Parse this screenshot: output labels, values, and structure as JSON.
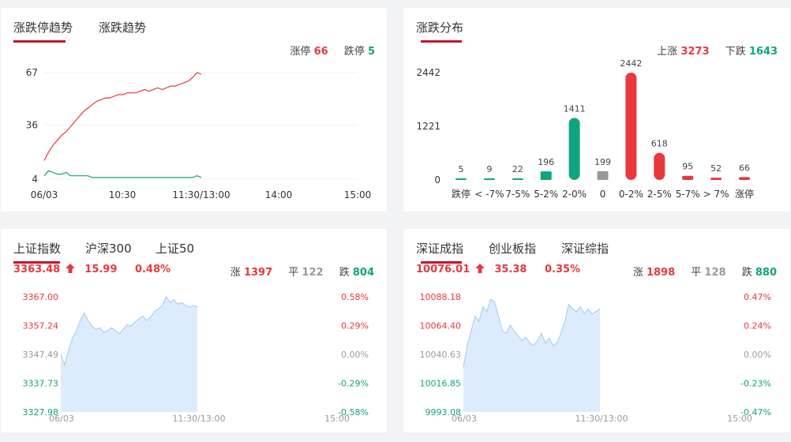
{
  "panel_limit": {
    "tabs": [
      "涨跌停趋势",
      "涨跌趋势"
    ],
    "limit_up_label": "涨停",
    "limit_up_value": "66",
    "limit_down_label": "跌停",
    "limit_down_value": "5"
  },
  "panel_dist": {
    "tabs": [
      "涨跌分布"
    ],
    "up_label": "上涨",
    "up_value": "3273",
    "down_label": "下跌",
    "down_value": "1643"
  },
  "panel_sh": {
    "tabs": [
      "上证指数",
      "沪深300",
      "上证50"
    ],
    "price": "3363.48",
    "change": "15.99",
    "pct": "0.48%",
    "up_label": "涨",
    "up_count": "1397",
    "flat_label": "平",
    "flat_count": "122",
    "down_label": "跌",
    "down_count": "804"
  },
  "panel_sz": {
    "tabs": [
      "深证成指",
      "创业板指",
      "深证综指"
    ],
    "price": "10076.01",
    "change": "35.38",
    "pct": "0.35%",
    "up_label": "涨",
    "up_count": "1898",
    "flat_label": "平",
    "flat_count": "128",
    "down_label": "跌",
    "down_count": "880"
  },
  "colors": {
    "up": "#e8383d",
    "down": "#10a37f",
    "flat": "#999999",
    "accent": "#c8102e",
    "area_fill": "#dcecfc",
    "area_line": "#9fc9f2"
  },
  "chart_data": [
    {
      "id": "limit_trend",
      "type": "line",
      "x_ticks": [
        "06/03",
        "10:30",
        "11:30/13:00",
        "14:00",
        "15:00"
      ],
      "y_ticks": [
        "67",
        "36",
        "4"
      ],
      "ylim": [
        4,
        67
      ],
      "series": [
        {
          "name": "涨停",
          "color": "#e8383d",
          "values": [
            15,
            20,
            24,
            27,
            30,
            32,
            35,
            38,
            41,
            44,
            46,
            48,
            50,
            51,
            52,
            52,
            53,
            54,
            54,
            55,
            55,
            55,
            56,
            57,
            56,
            57,
            58,
            57,
            58,
            59,
            59,
            60,
            61,
            62,
            64,
            67,
            66
          ]
        },
        {
          "name": "跌停",
          "color": "#10a37f",
          "values": [
            6,
            9,
            8,
            7,
            7,
            8,
            6,
            6,
            6,
            6,
            6,
            5,
            5,
            5,
            5,
            5,
            5,
            5,
            5,
            5,
            5,
            5,
            5,
            5,
            5,
            5,
            5,
            5,
            5,
            5,
            5,
            5,
            5,
            5,
            5,
            6,
            5
          ]
        }
      ]
    },
    {
      "id": "distribution",
      "type": "bar",
      "categories": [
        "跌停",
        "< -7%",
        "7-5%",
        "5-2%",
        "2-0%",
        "0",
        "0-2%",
        "2-5%",
        "5-7%",
        "> 7%",
        "涨停"
      ],
      "values": [
        5,
        9,
        22,
        196,
        1411,
        199,
        2442,
        618,
        95,
        52,
        66
      ],
      "colors": [
        "#10a37f",
        "#10a37f",
        "#10a37f",
        "#10a37f",
        "#10a37f",
        "#999999",
        "#e8383d",
        "#e8383d",
        "#e8383d",
        "#e8383d",
        "#e8383d"
      ],
      "y_ticks": [
        "2442",
        "1221",
        "0"
      ],
      "ylim": [
        0,
        2442
      ]
    },
    {
      "id": "sh_index",
      "type": "area",
      "x_ticks": [
        "06/03",
        "11:30/13:00",
        "15:00"
      ],
      "y_ticks_left": [
        "3367.00",
        "3357.24",
        "3347.49",
        "3337.73",
        "3327.98"
      ],
      "y_ticks_right": [
        "0.58%",
        "0.29%",
        "0.00%",
        "-0.29%",
        "-0.58%"
      ],
      "ylim": [
        3327.98,
        3367.0
      ],
      "values": [
        3347.5,
        3344.0,
        3349.0,
        3353.0,
        3355.5,
        3359.0,
        3361.5,
        3359.0,
        3357.0,
        3356.0,
        3356.5,
        3355.0,
        3355.5,
        3356.5,
        3355.5,
        3354.5,
        3356.0,
        3357.5,
        3357.0,
        3358.5,
        3359.5,
        3360.5,
        3359.0,
        3360.0,
        3362.0,
        3363.0,
        3364.0,
        3367.0,
        3365.0,
        3366.0,
        3364.5,
        3365.0,
        3364.0,
        3363.5,
        3364.0,
        3363.5
      ]
    },
    {
      "id": "sz_index",
      "type": "area",
      "x_ticks": [
        "06/03",
        "11:30/13:00",
        "15:00"
      ],
      "y_ticks_left": [
        "10088.18",
        "10064.40",
        "10040.63",
        "10016.85",
        "9993.08"
      ],
      "y_ticks_right": [
        "0.47%",
        "0.24%",
        "0.00%",
        "-0.23%",
        "-0.47%"
      ],
      "ylim": [
        9993.08,
        10088.18
      ],
      "values": [
        10030,
        10048,
        10060,
        10072,
        10068,
        10080,
        10076,
        10086,
        10084,
        10072,
        10060,
        10058,
        10065,
        10060,
        10056,
        10052,
        10055,
        10050,
        10048,
        10052,
        10058,
        10050,
        10054,
        10048,
        10050,
        10058,
        10068,
        10082,
        10078,
        10076,
        10080,
        10074,
        10078,
        10074,
        10076,
        10078
      ]
    }
  ]
}
